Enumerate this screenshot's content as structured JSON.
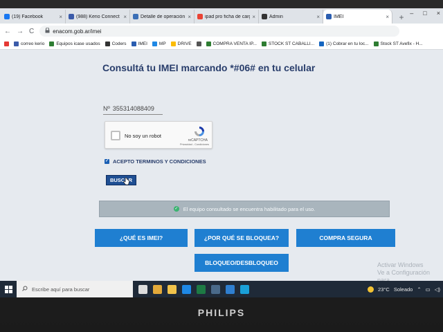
{
  "browser": {
    "tabs": [
      {
        "label": "(19) Facebook",
        "color": "#1877f2",
        "active": false
      },
      {
        "label": "(988) Kerio Connect C",
        "color": "#3b5ba9",
        "active": false
      },
      {
        "label": "Detalle de operación",
        "color": "#3b6fb6",
        "active": false
      },
      {
        "label": "ipad pro ficha de carg",
        "color": "#ea4335",
        "active": false
      },
      {
        "label": "Admin",
        "color": "#333333",
        "active": false
      },
      {
        "label": "IMEI",
        "color": "#2a5db0",
        "active": true
      }
    ],
    "close_glyph": "×",
    "new_tab_glyph": "+",
    "window_controls": [
      "–",
      "□",
      "×"
    ],
    "nav": {
      "back": "←",
      "forward": "→",
      "reload": "C"
    },
    "url": "enacom.gob.ar/imei",
    "bookmarks": [
      {
        "label": "",
        "color": "#e53935"
      },
      {
        "label": "correo kerio",
        "color": "#3b5ba9"
      },
      {
        "label": "Equipos icase usados",
        "color": "#2e7d32"
      },
      {
        "label": "Coders",
        "color": "#333333"
      },
      {
        "label": "IMEI",
        "color": "#2a5db0"
      },
      {
        "label": "MP",
        "color": "#1e88e5"
      },
      {
        "label": "DRIVE",
        "color": "#fbbc04"
      },
      {
        "label": "",
        "color": "#555555"
      },
      {
        "label": "COMPRA VENTA IP...",
        "color": "#2e7d32"
      },
      {
        "label": "STOCK ST CABALLI...",
        "color": "#2e7d32"
      },
      {
        "label": "(1) Cobrar en tu loc...",
        "color": "#1565c0"
      },
      {
        "label": "Stock ST Avefix - H...",
        "color": "#2e7d32"
      }
    ]
  },
  "page": {
    "title": "Consultá tu IMEI marcando *#06# en tu celular",
    "imei_prefix": "Nº",
    "imei_value": "355314088409",
    "captcha": {
      "label": "No soy un robot",
      "brand": "reCAPTCHA",
      "privacy": "Privacidad - Condiciones"
    },
    "accept_label": "ACEPTO TERMINOS Y CONDICIONES",
    "accept_checked": true,
    "search_button": "BUSCAR",
    "result_message": "El equipo consultado se encuentra habilitado para el uso.",
    "buttons": {
      "imei": "¿QUÉ ES IMEI?",
      "bloquea": "¿POR QUÉ SE BLOQUEA?",
      "compra": "COMPRA SEGURA",
      "bloqueo": "BLOQUEO/DESBLOQUEO"
    },
    "watermark": [
      "Activar Windows",
      "Ve a Configuración para"
    ]
  },
  "taskbar": {
    "search_placeholder": "Escribe aquí para buscar",
    "weather_temp": "23°C",
    "weather_desc": "Soleado",
    "icons": [
      "task-view",
      "chrome",
      "file-explorer",
      "teamviewer",
      "excel",
      "calculator",
      "photos",
      "edge"
    ],
    "icon_colors": [
      "#dddddd",
      "#e2a93a",
      "#f0c24b",
      "#1e88e5",
      "#1d7a44",
      "#4a6a8a",
      "#2f7fd0",
      "#1aa0d8"
    ]
  },
  "monitor": {
    "brand": "PHILIPS"
  }
}
